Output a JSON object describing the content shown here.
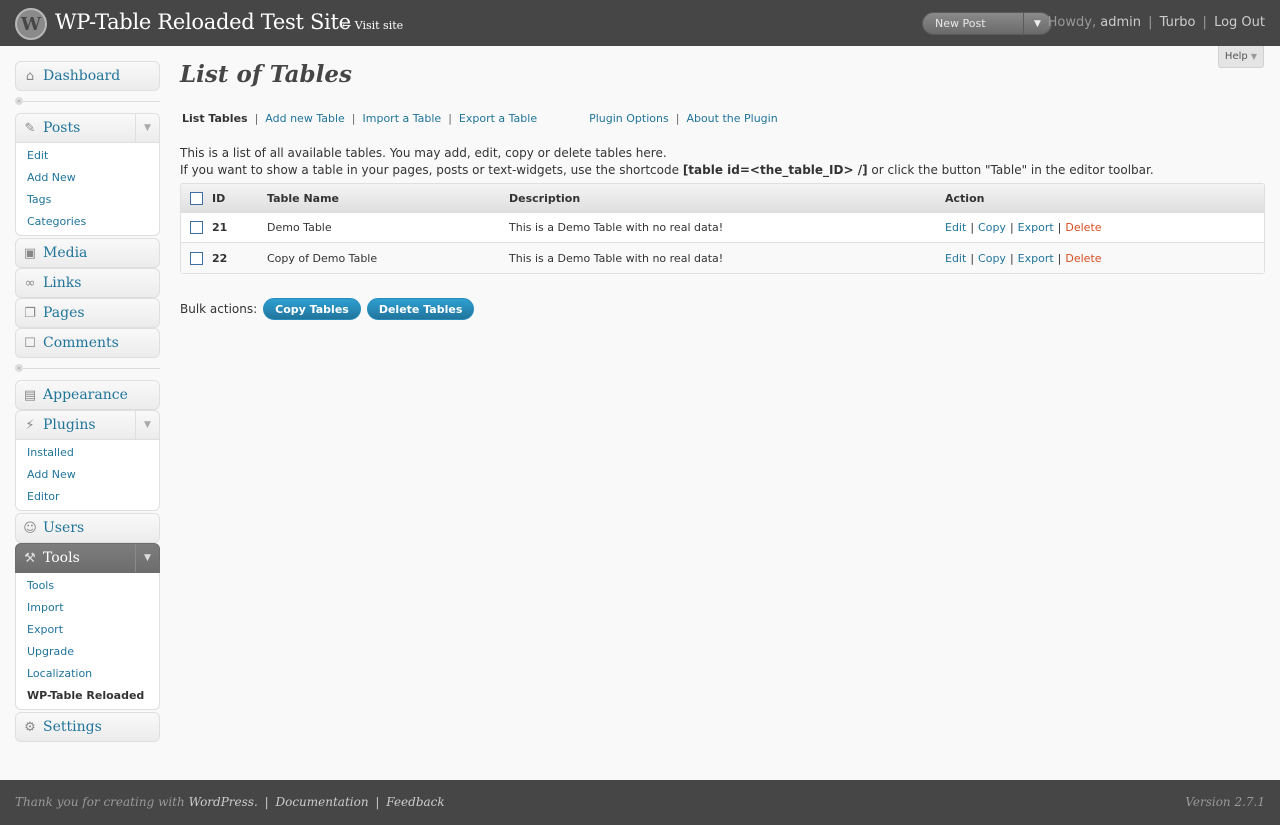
{
  "header": {
    "site_title": "WP-Table Reloaded Test Site",
    "visit_site": "← Visit site",
    "new_post": "New Post",
    "howdy": "Howdy,",
    "user": "admin",
    "turbo": "Turbo",
    "logout": "Log Out"
  },
  "help": {
    "label": "Help"
  },
  "sidebar": {
    "dashboard": "Dashboard",
    "posts": {
      "label": "Posts",
      "items": [
        "Edit",
        "Add New",
        "Tags",
        "Categories"
      ]
    },
    "media": "Media",
    "links": "Links",
    "pages": "Pages",
    "comments": "Comments",
    "appearance": "Appearance",
    "plugins": {
      "label": "Plugins",
      "items": [
        "Installed",
        "Add New",
        "Editor"
      ]
    },
    "users": "Users",
    "tools": {
      "label": "Tools",
      "items": [
        "Tools",
        "Import",
        "Export",
        "Upgrade",
        "Localization",
        "WP-Table Reloaded"
      ]
    },
    "settings": "Settings"
  },
  "main": {
    "title": "List of Tables",
    "subnav": {
      "list_tables": "List Tables",
      "add_new": "Add new Table",
      "import": "Import a Table",
      "export": "Export a Table",
      "plugin_options": "Plugin Options",
      "about": "About the Plugin"
    },
    "intro_line1": "This is a list of all available tables. You may add, edit, copy or delete tables here.",
    "intro_line2_pre": "If you want to show a table in your pages, posts or text-widgets, use the shortcode",
    "intro_shortcode": "[table id=<the_table_ID> /]",
    "intro_line2_post": "or click the button \"Table\" in the editor toolbar.",
    "table": {
      "headers": {
        "id": "ID",
        "name": "Table Name",
        "description": "Description",
        "action": "Action"
      },
      "rows": [
        {
          "id": "21",
          "name": "Demo Table",
          "description": "This is a Demo Table with no real data!"
        },
        {
          "id": "22",
          "name": "Copy of Demo Table",
          "description": "This is a Demo Table with no real data!"
        }
      ],
      "actions": {
        "edit": "Edit",
        "copy": "Copy",
        "export": "Export",
        "delete": "Delete"
      }
    },
    "bulk": {
      "label": "Bulk actions:",
      "copy": "Copy Tables",
      "delete": "Delete Tables"
    }
  },
  "footer": {
    "thanks": "Thank you for creating with",
    "wordpress": "WordPress.",
    "documentation": "Documentation",
    "feedback": "Feedback",
    "version": "Version 2.7.1"
  },
  "colors": {
    "header_bg": "#464646",
    "link": "#21759b",
    "delete": "#d54e21",
    "button": "#21759b",
    "current_menu": "#6d6d6d"
  }
}
